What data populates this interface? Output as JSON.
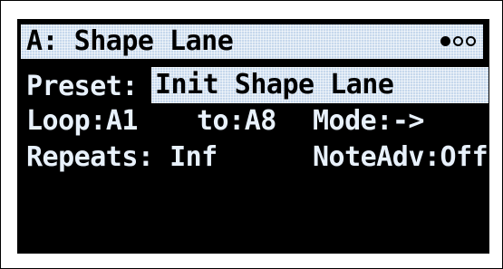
{
  "header": {
    "title": "A: Shape Lane",
    "page_indicator": [
      "filled",
      "empty",
      "empty"
    ]
  },
  "params": {
    "preset": {
      "label": "Preset:",
      "value": "Init Shape Lane"
    },
    "loop": {
      "label": "Loop:",
      "value": "A1"
    },
    "to": {
      "label": "to:",
      "value": "A8"
    },
    "mode": {
      "label": "Mode:",
      "value": "->"
    },
    "repeats": {
      "label": "Repeats:",
      "value": "Inf"
    },
    "note_adv": {
      "label": "NoteAdv:",
      "value": "Off"
    }
  },
  "colors": {
    "screen_bg": "#000000",
    "highlight": "#c6d8ec",
    "text": "#e8f1fb"
  }
}
